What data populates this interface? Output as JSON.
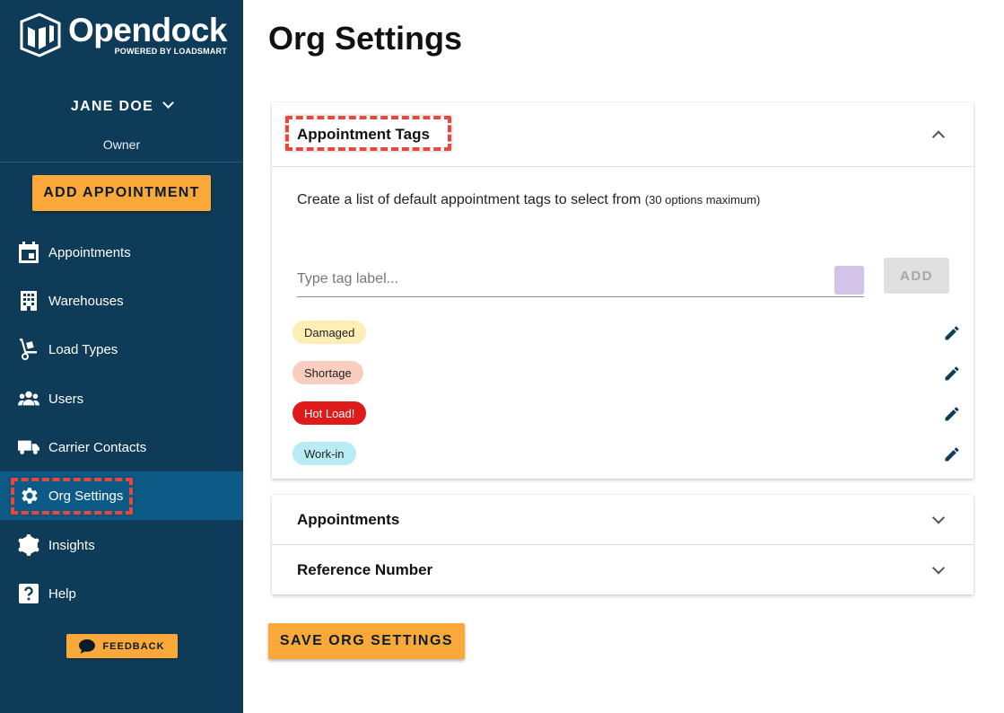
{
  "brand": {
    "name": "Opendock",
    "tagline": "POWERED BY LOADSMART"
  },
  "user": {
    "name": "JANE DOE",
    "role": "Owner"
  },
  "sidebar": {
    "add_button": "ADD APPOINTMENT",
    "items": [
      {
        "label": "Appointments",
        "icon": "calendar-icon"
      },
      {
        "label": "Warehouses",
        "icon": "building-icon"
      },
      {
        "label": "Load Types",
        "icon": "hand-truck-icon"
      },
      {
        "label": "Users",
        "icon": "users-icon"
      },
      {
        "label": "Carrier Contacts",
        "icon": "truck-icon"
      },
      {
        "label": "Org Settings",
        "icon": "gear-icon",
        "active": true
      },
      {
        "label": "Insights",
        "icon": "graph-icon"
      },
      {
        "label": "Help",
        "icon": "help-icon"
      }
    ],
    "feedback_label": "FEEDBACK"
  },
  "page": {
    "title": "Org Settings"
  },
  "tags_section": {
    "title": "Appointment Tags",
    "description": "Create a list of default appointment tags to select from",
    "description_note": "(30 options maximum)",
    "input_placeholder": "Type tag label...",
    "swatch_color": "#d3c3e8",
    "add_label": "ADD",
    "tags": [
      {
        "label": "Damaged",
        "color": "#fdeeb5"
      },
      {
        "label": "Shortage",
        "color": "#f9cdbf"
      },
      {
        "label": "Hot Load!",
        "color": "#de1a1a",
        "text_color": "#ffffff"
      },
      {
        "label": "Work-in",
        "color": "#b8ebf3"
      }
    ]
  },
  "sections": [
    {
      "title": "Appointments"
    },
    {
      "title": "Reference Number"
    }
  ],
  "save_label": "SAVE ORG SETTINGS",
  "colors": {
    "sidebar_bg": "#0e3b58",
    "sidebar_active": "#0d5a86",
    "accent": "#fba83a",
    "highlight": "#e8473e"
  }
}
